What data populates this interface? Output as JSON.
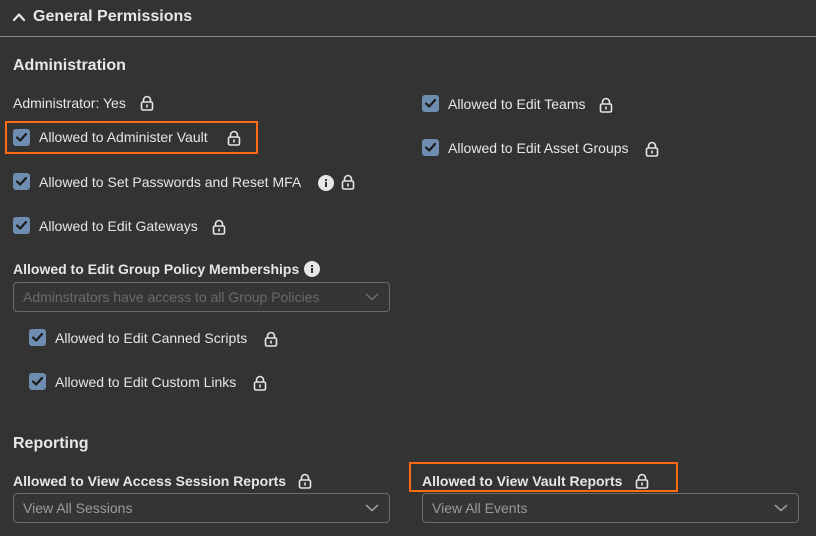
{
  "header": {
    "title": "General Permissions"
  },
  "administration": {
    "title": "Administration",
    "administrator_label": "Administrator: Yes",
    "left_items": [
      {
        "label": "Allowed to Administer Vault",
        "checked": true
      },
      {
        "label": "Allowed to Set Passwords and Reset MFA",
        "checked": true
      },
      {
        "label": "Allowed to Edit Gateways",
        "checked": true
      }
    ],
    "right_items": [
      {
        "label": "Allowed to Edit Teams",
        "checked": true
      },
      {
        "label": "Allowed to Edit Asset Groups",
        "checked": true
      }
    ],
    "group_policy": {
      "label": "Allowed to Edit Group Policy Memberships",
      "select_value": "Adminstrators have access to all Group Policies",
      "sub_items": [
        {
          "label": "Allowed to Edit Canned Scripts",
          "checked": true
        },
        {
          "label": "Allowed to Edit Custom Links",
          "checked": true
        }
      ]
    }
  },
  "reporting": {
    "title": "Reporting",
    "access_session": {
      "label": "Allowed to View Access Session Reports",
      "select_value": "View All Sessions"
    },
    "vault_reports": {
      "label": "Allowed to View Vault Reports",
      "select_value": "View All Events"
    }
  },
  "colors": {
    "highlight": "#ff6a13",
    "checkbox": "#6e8db0",
    "background": "#333333"
  },
  "icons": [
    "chevron-up-icon",
    "lock-icon",
    "info-icon",
    "checkmark-icon",
    "chevron-down-icon"
  ]
}
